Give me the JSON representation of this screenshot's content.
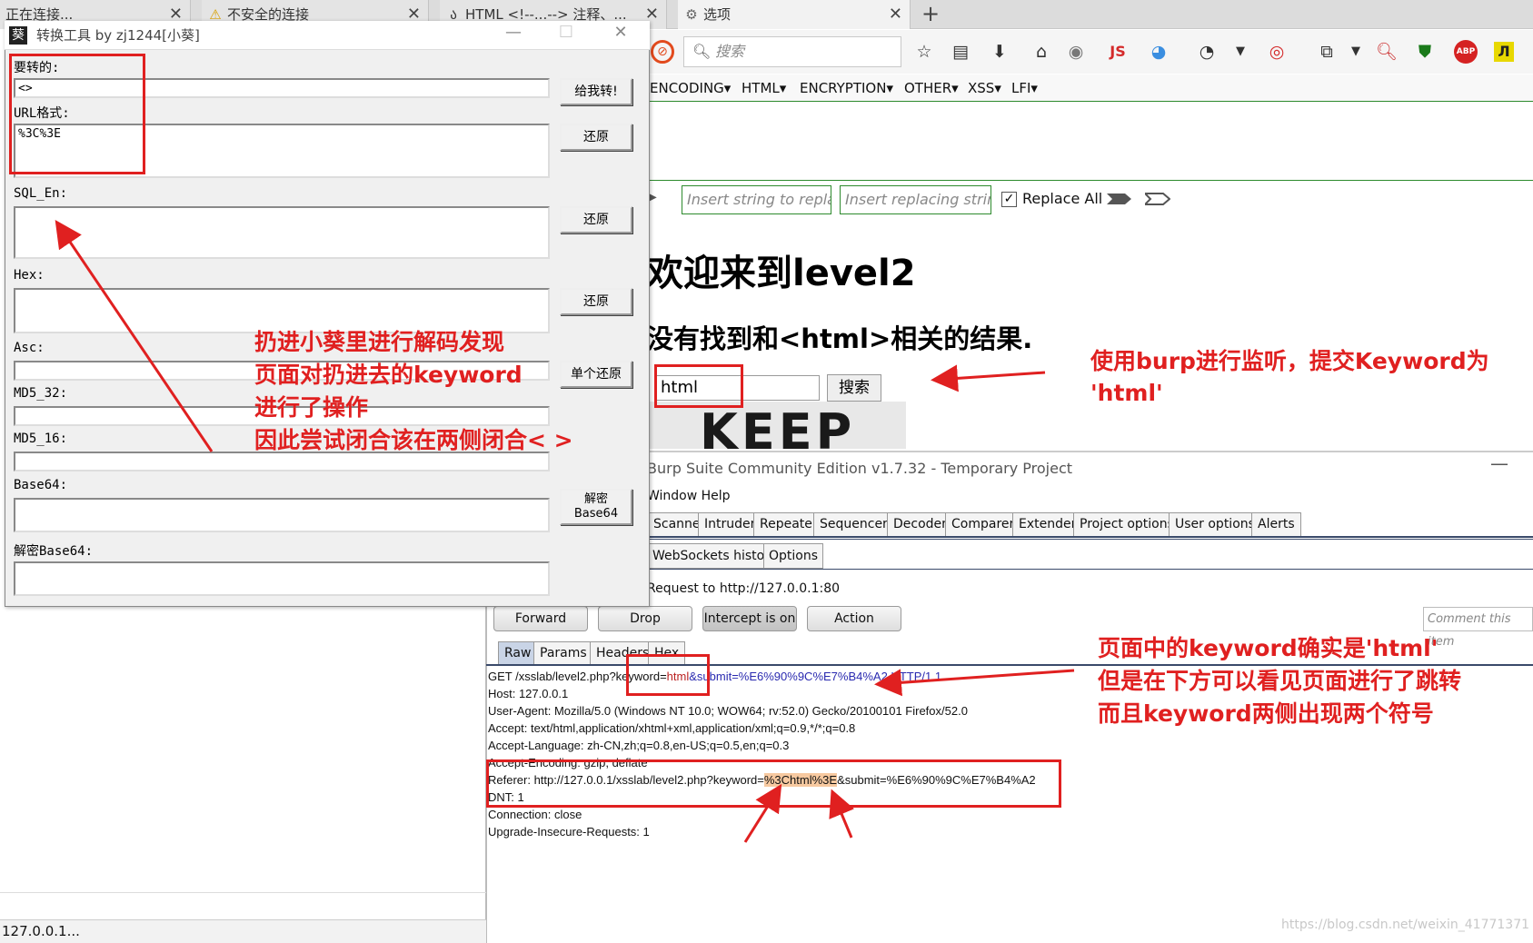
{
  "tabs": [
    {
      "label": "正在连接..."
    },
    {
      "label": "不安全的连接"
    },
    {
      "label": "HTML <!--...--> 注释、..."
    },
    {
      "label": "选项"
    }
  ],
  "search": {
    "placeholder": "搜索"
  },
  "toolbar_icons": [
    "star-icon",
    "reader-icon",
    "download-icon",
    "home-icon",
    "globe-icon",
    "js-icon",
    "translate-icon",
    "palette-icon",
    "target-icon",
    "screenshot-icon",
    "zoom-icon",
    "shield-icon",
    "adblock-icon",
    "notes-icon"
  ],
  "toolbar_text": {
    "js": "JS",
    "abp": "ABP"
  },
  "hackbar": {
    "menu": [
      "ENCODING▾",
      "HTML▾",
      "ENCRYPTION▾",
      "OTHER▾",
      "XSS▾",
      "LFI▾"
    ],
    "replace_placeholder": "Insert string to replace",
    "replacing_placeholder": "Insert replacing string",
    "replace_all": "Replace All"
  },
  "page": {
    "title": "欢迎来到level2",
    "subtitle": "没有找到和<html>相关的结果.",
    "keyword": "html",
    "search_button": "搜索",
    "logo_text": "KEEP"
  },
  "converter": {
    "title": "转换工具 by zj1244[小葵]",
    "labels": {
      "input": "要转的:",
      "url": "URL格式:",
      "sql": "SQL_En:",
      "hex": "Hex:",
      "asc": "Asc:",
      "md5_32": "MD5_32:",
      "md5_16": "MD5_16:",
      "base64": "Base64:",
      "dec_base64": "解密Base64:"
    },
    "values": {
      "input": "<>",
      "url": "%3C%3E"
    },
    "buttons": {
      "convert": "给我转!",
      "restore": "还原",
      "single_restore": "单个还原",
      "decode_base64": "解密\nBase64"
    }
  },
  "burp": {
    "title": "Burp Suite Community Edition v1.7.32 - Temporary Project",
    "menu": "Window   Help",
    "tabs": [
      "Scanner",
      "Intruder",
      "Repeater",
      "Sequencer",
      "Decoder",
      "Comparer",
      "Extender",
      "Project options",
      "User options",
      "Alerts"
    ],
    "subtabs": [
      "WebSockets history",
      "Options"
    ],
    "host": "Request to http://127.0.0.1:80",
    "buttons": {
      "forward": "Forward",
      "drop": "Drop",
      "intercept": "Intercept is on",
      "action": "Action"
    },
    "comment_placeholder": "Comment this item",
    "view_tabs": [
      "Raw",
      "Params",
      "Headers",
      "Hex"
    ],
    "request": {
      "get_prefix": "GET /xsslab/level2.php?keyword=",
      "get_keyword": "html",
      "get_suffix": "&submit=%E6%90%9C%E7%B4%A2 HTTP/1.1",
      "host": "Host: 127.0.0.1",
      "user_agent": "User-Agent: Mozilla/5.0 (Windows NT 10.0; WOW64; rv:52.0) Gecko/20100101 Firefox/52.0",
      "accept": "Accept: text/html,application/xhtml+xml,application/xml;q=0.9,*/*;q=0.8",
      "accept_language": "Accept-Language: zh-CN,zh;q=0.8,en-US;q=0.5,en;q=0.3",
      "accept_encoding": "Accept-Encoding: gzip, deflate",
      "referer_prefix": "Referer: http://127.0.0.1/xsslab/level2.php?keyword=",
      "referer_keyword": "%3Chtml%3E",
      "referer_suffix": "&submit=%E6%90%9C%E7%B4%A2",
      "dnt": "DNT: 1",
      "connection": "Connection: close",
      "upgrade": "Upgrade-Insecure-Requests: 1"
    }
  },
  "left_status": "127.0.0.1...",
  "annotations": {
    "note1": "扔进小葵里进行解码发现\n页面对扔进去的keyword\n进行了操作\n因此尝试闭合该在两侧闭合< >",
    "note2": "使用burp进行监听，提交Keyword为\n'html'",
    "note3": "页面中的keyword确实是'html'\n但是在下方可以看见页面进行了跳转\n而且keyword两侧出现两个符号"
  },
  "watermark": "https://blog.csdn.net/weixin_41771371",
  "colors": {
    "annotation": "#e02020",
    "hackbar_green": "#2d8a2d",
    "highlight": "#f7c9a0"
  }
}
